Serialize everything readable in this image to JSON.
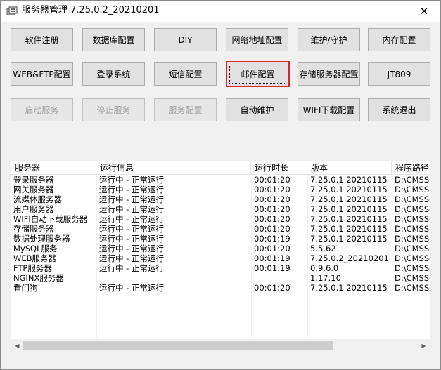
{
  "window": {
    "title": "服务器管理 7.25.0.2_20210201",
    "close_symbol": "✕"
  },
  "buttons": {
    "row1": [
      "软件注册",
      "数据库配置",
      "DIY",
      "网络地址配置",
      "维护/守护",
      "内存配置"
    ],
    "row2": [
      "WEB&FTP配置",
      "登录系统",
      "短信配置",
      "邮件配置",
      "存储服务器配置",
      "JT809"
    ],
    "row3": [
      "启动服务",
      "停止服务",
      "服务配置",
      "自动维护",
      "WIFI下载配置",
      "系统退出"
    ]
  },
  "table": {
    "columns": [
      "服务器",
      "运行信息",
      "运行时长",
      "版本",
      "程序路径"
    ],
    "rows": [
      [
        "登录服务器",
        "运行中 - 正常运行",
        "00:01:20",
        "7.25.0.1 20210115",
        "D:\\CMSServer"
      ],
      [
        "网关服务器",
        "运行中 - 正常运行",
        "00:01:20",
        "7.25.0.1 20210115",
        "D:\\CMSServer"
      ],
      [
        "流媒体服务器",
        "运行中 - 正常运行",
        "00:01:20",
        "7.25.0.1 20210115",
        "D:\\CMSServer"
      ],
      [
        "用户服务器",
        "运行中 - 正常运行",
        "00:01:20",
        "7.25.0.1 20210115",
        "D:\\CMSServer"
      ],
      [
        "WIFI自动下载服务器",
        "运行中 - 正常运行",
        "00:01:20",
        "7.25.0.1 20210115",
        "D:\\CMSServer"
      ],
      [
        "存储服务器",
        "运行中 - 正常运行",
        "00:01:20",
        "7.25.0.1 20210115",
        "D:\\CMSServer"
      ],
      [
        "数据处理服务器",
        "运行中 - 正常运行",
        "00:01:19",
        "7.25.0.1 20210115",
        "D:\\CMSServer"
      ],
      [
        "MySQL服务",
        "运行中 - 正常运行",
        "00:01:20",
        "5.5.62",
        "D:\\CMSServer"
      ],
      [
        "WEB服务器",
        "运行中 - 正常运行",
        "00:01:19",
        "7.25.0.2_20210201",
        "D:\\CMSServer"
      ],
      [
        "FTP服务器",
        "运行中 - 正常运行",
        "00:01:19",
        "0.9.6.0",
        "D:\\CMSServer"
      ],
      [
        "NGINX服务器",
        "",
        "",
        "1.17.10",
        "D:\\CMSServer"
      ],
      [
        "看门狗",
        "运行中 - 正常运行",
        "00:01:20",
        "7.25.0.1 20210115",
        "D:\\CMSServer"
      ]
    ]
  },
  "scrollbar": {
    "left_arrow": "◀",
    "right_arrow": "▶"
  }
}
